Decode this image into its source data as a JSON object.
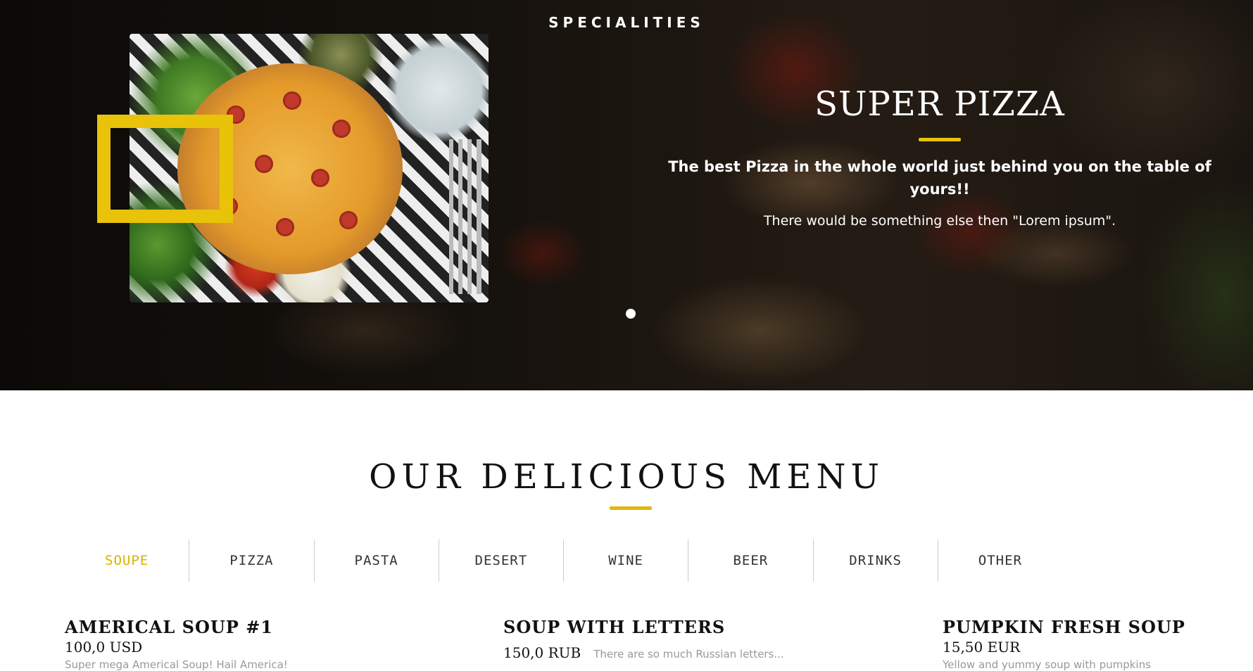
{
  "hero": {
    "kicker": "SPECIALITIES",
    "slide": {
      "title": "SUPER PIZZA",
      "subtitle": "The best Pizza in the whole world just behind you on the table of yours!!",
      "description": "There would be something else then \"Lorem ipsum\"."
    },
    "accent_color": "#e8c30a"
  },
  "menu": {
    "title": "OUR DELICIOUS MENU",
    "tabs": [
      {
        "label": "SOUPE",
        "active": true
      },
      {
        "label": "PIZZA"
      },
      {
        "label": "PASTA"
      },
      {
        "label": "DESERT"
      },
      {
        "label": "WINE"
      },
      {
        "label": "BEER"
      },
      {
        "label": "DRINKS"
      },
      {
        "label": "OTHER"
      }
    ],
    "items": [
      {
        "name": "AMERICAL SOUP #1",
        "price": "100,0 USD",
        "description": "Super mega Americal Soup! Hail America!"
      },
      {
        "name": "SOUP WITH LETTERS",
        "price": "150,0 RUB",
        "description": "There are so much Russian letters..."
      },
      {
        "name": "PUMPKIN FRESH SOUP",
        "price": "15,50 EUR",
        "description": "Yellow and yummy soup with pumpkins"
      }
    ],
    "active_color": "#d9b300"
  }
}
